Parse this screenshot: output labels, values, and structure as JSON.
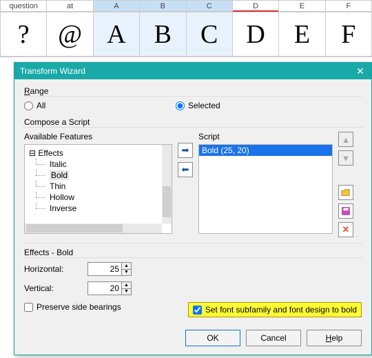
{
  "grid": {
    "headers": [
      "question",
      "at",
      "A",
      "B",
      "C",
      "D",
      "E",
      "F"
    ],
    "cells": [
      "?",
      "@",
      "A",
      "B",
      "C",
      "D",
      "E",
      "F"
    ],
    "selected": [
      2,
      3,
      4
    ]
  },
  "dialog": {
    "title": "Transform Wizard",
    "range_label": "Range",
    "all_label": "All",
    "selected_label": "Selected",
    "compose_label": "Compose a Script",
    "avail_label": "Available Features",
    "script_label": "Script",
    "tree_root": "Effects",
    "tree_items": [
      "Italic",
      "Bold",
      "Thin",
      "Hollow",
      "Inverse"
    ],
    "script_item": "Bold (25, 20)",
    "section_title": "Effects - Bold",
    "horizontal_label": "Horizontal:",
    "vertical_label": "Vertical:",
    "horizontal_value": "25",
    "vertical_value": "20",
    "preserve_label": "Preserve side bearings",
    "subfamily_label": "Set font subfamily and font design to bold",
    "ok": "OK",
    "cancel": "Cancel",
    "help": "Help"
  }
}
